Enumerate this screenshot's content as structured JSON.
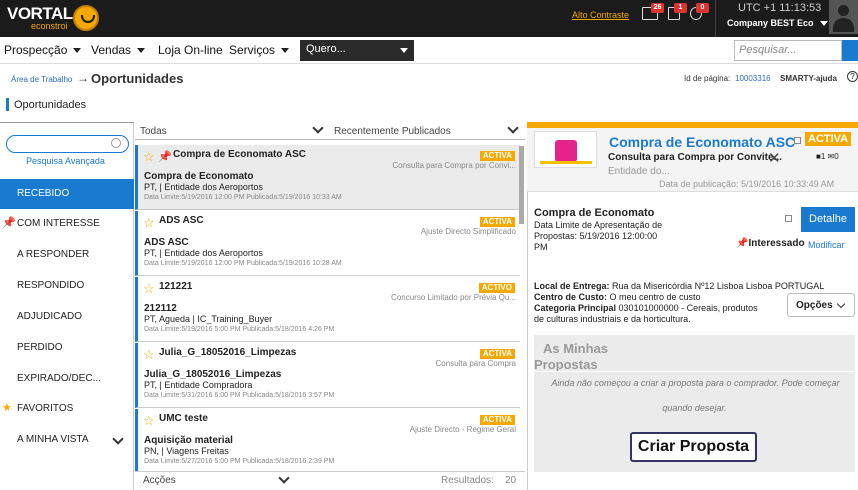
{
  "topbar": {
    "logo": "VORTAL",
    "logo_sub": "econstroi",
    "alto_contraste": "Alto Contraste",
    "badges": [
      "26",
      "1",
      "0"
    ],
    "utc": "UTC +1 11:13:53",
    "company": "Company BEST Eco"
  },
  "menu": {
    "items": [
      "Prospecção",
      "Vendas",
      "Loja On-line",
      "Serviços"
    ],
    "quero": "Quero...",
    "search_placeholder": "Pesquisar..."
  },
  "breadcrumb": {
    "root": "Área de Trabalho",
    "arrow": "→",
    "current": "Oportunidades",
    "page_id_label": "Id de página:",
    "page_id": "10003316",
    "help": "SMARTY-ajuda",
    "help_icon": "?"
  },
  "section_title": "Oportunidades",
  "leftnav": {
    "advanced_search": "Pesquisa Avançada",
    "items": [
      {
        "label": "RECEBIDO",
        "icon": ""
      },
      {
        "label": "COM INTERESSE",
        "icon": "pin-icon"
      },
      {
        "label": "A RESPONDER",
        "icon": ""
      },
      {
        "label": "RESPONDIDO",
        "icon": ""
      },
      {
        "label": "ADJUDICADO",
        "icon": ""
      },
      {
        "label": "PERDIDO",
        "icon": ""
      },
      {
        "label": "EXPIRADO/DEC...",
        "icon": ""
      },
      {
        "label": "FAVORITOS",
        "icon": "star-icon"
      },
      {
        "label": "A MINHA VISTA",
        "icon": ""
      }
    ]
  },
  "list": {
    "filter_left": "Todas",
    "filter_right": "Recentemente Publicados",
    "rows": [
      {
        "name": "Compra de Economato ASC",
        "status": "ACTIVA",
        "type": "Consulta para Compra por Convi...",
        "title": "Compra de Economato",
        "org": "PT, | Entidade dos Aeroportos",
        "dates": "Data Limite:5/19/2016 12:00 PM Publicada:5/19/2016 10:33 AM"
      },
      {
        "name": "ADS ASC",
        "status": "ACTIVA",
        "type": "Ajuste Directo Simplificado",
        "title": "ADS ASC",
        "org": "PT, | Entidade dos Aeroportos",
        "dates": "Data Limite:5/19/2016 12:00 PM Publicada:5/19/2016 10:28 AM"
      },
      {
        "name": "121221",
        "status": "ACTIVO",
        "type": "Concurso Limitado por Prévia Qu...",
        "title": "212112",
        "org": "PT, Agueda | IC_Training_Buyer",
        "dates": "Data Limite:5/19/2016 5:00 PM Publicada:5/18/2016 4:26 PM"
      },
      {
        "name": "Julia_G_18052016_Limpezas",
        "status": "ACTIVA",
        "type": "Consulta para Compra",
        "title": "Julia_G_18052016_Limpezas",
        "org": "PT, | Entidade Compradora",
        "dates": "Data Limite:5/31/2016 6:00 PM Publicada:5/18/2016 3:57 PM"
      },
      {
        "name": "UMC teste",
        "status": "ACTIVA",
        "type": "Ajuste Directo - Regime Geral",
        "title": "Aquisição material",
        "org": "PN, | Viagens Freitas",
        "dates": "Data Limite:5/27/2016 5:00 PM Publicada:5/18/2016 2:39 PM"
      }
    ],
    "actions": "Acções",
    "results_label": "Resultados:",
    "results_count": "20"
  },
  "detail": {
    "title": "Compra de Economato ASC",
    "status": "ACTIVA",
    "subtitle": "Consulta para Compra por Convite...",
    "close": "✕",
    "entity": "Entidade do...",
    "pubdate": "Data de publicação: 5/19/2016 10:33:49 AM",
    "counts": [
      "1",
      "0"
    ],
    "name": "Compra de Economato",
    "deadline_l1": "Data Limite de Apresentação de",
    "deadline_l2": "Propostas: 5/19/2016 12:00:00",
    "deadline_l3": "PM",
    "detail_button": "Detalhe",
    "interested": "Interessado",
    "modify": "Modificar",
    "delivery_label": "Local de Entrega:",
    "delivery_value": "Rua da Misericórdia Nº12 Lisboa Lisboa PORTUGAL",
    "cost_label": "Centro de Custo:",
    "cost_value": "O meu centro de custo",
    "category_label": "Categoria Principal",
    "category_value": "030101000000 - Cereais, produtos",
    "category_value2": "de culturas industriais e da horticultura.",
    "options": "Opções",
    "proposals_t1": "As Minhas",
    "proposals_t2": "Propostas",
    "proposals_msg1": "Ainda não começou a criar a proposta para o comprador. Pode começar",
    "proposals_msg2": "quando desejar.",
    "create_button": "Criar Proposta"
  }
}
